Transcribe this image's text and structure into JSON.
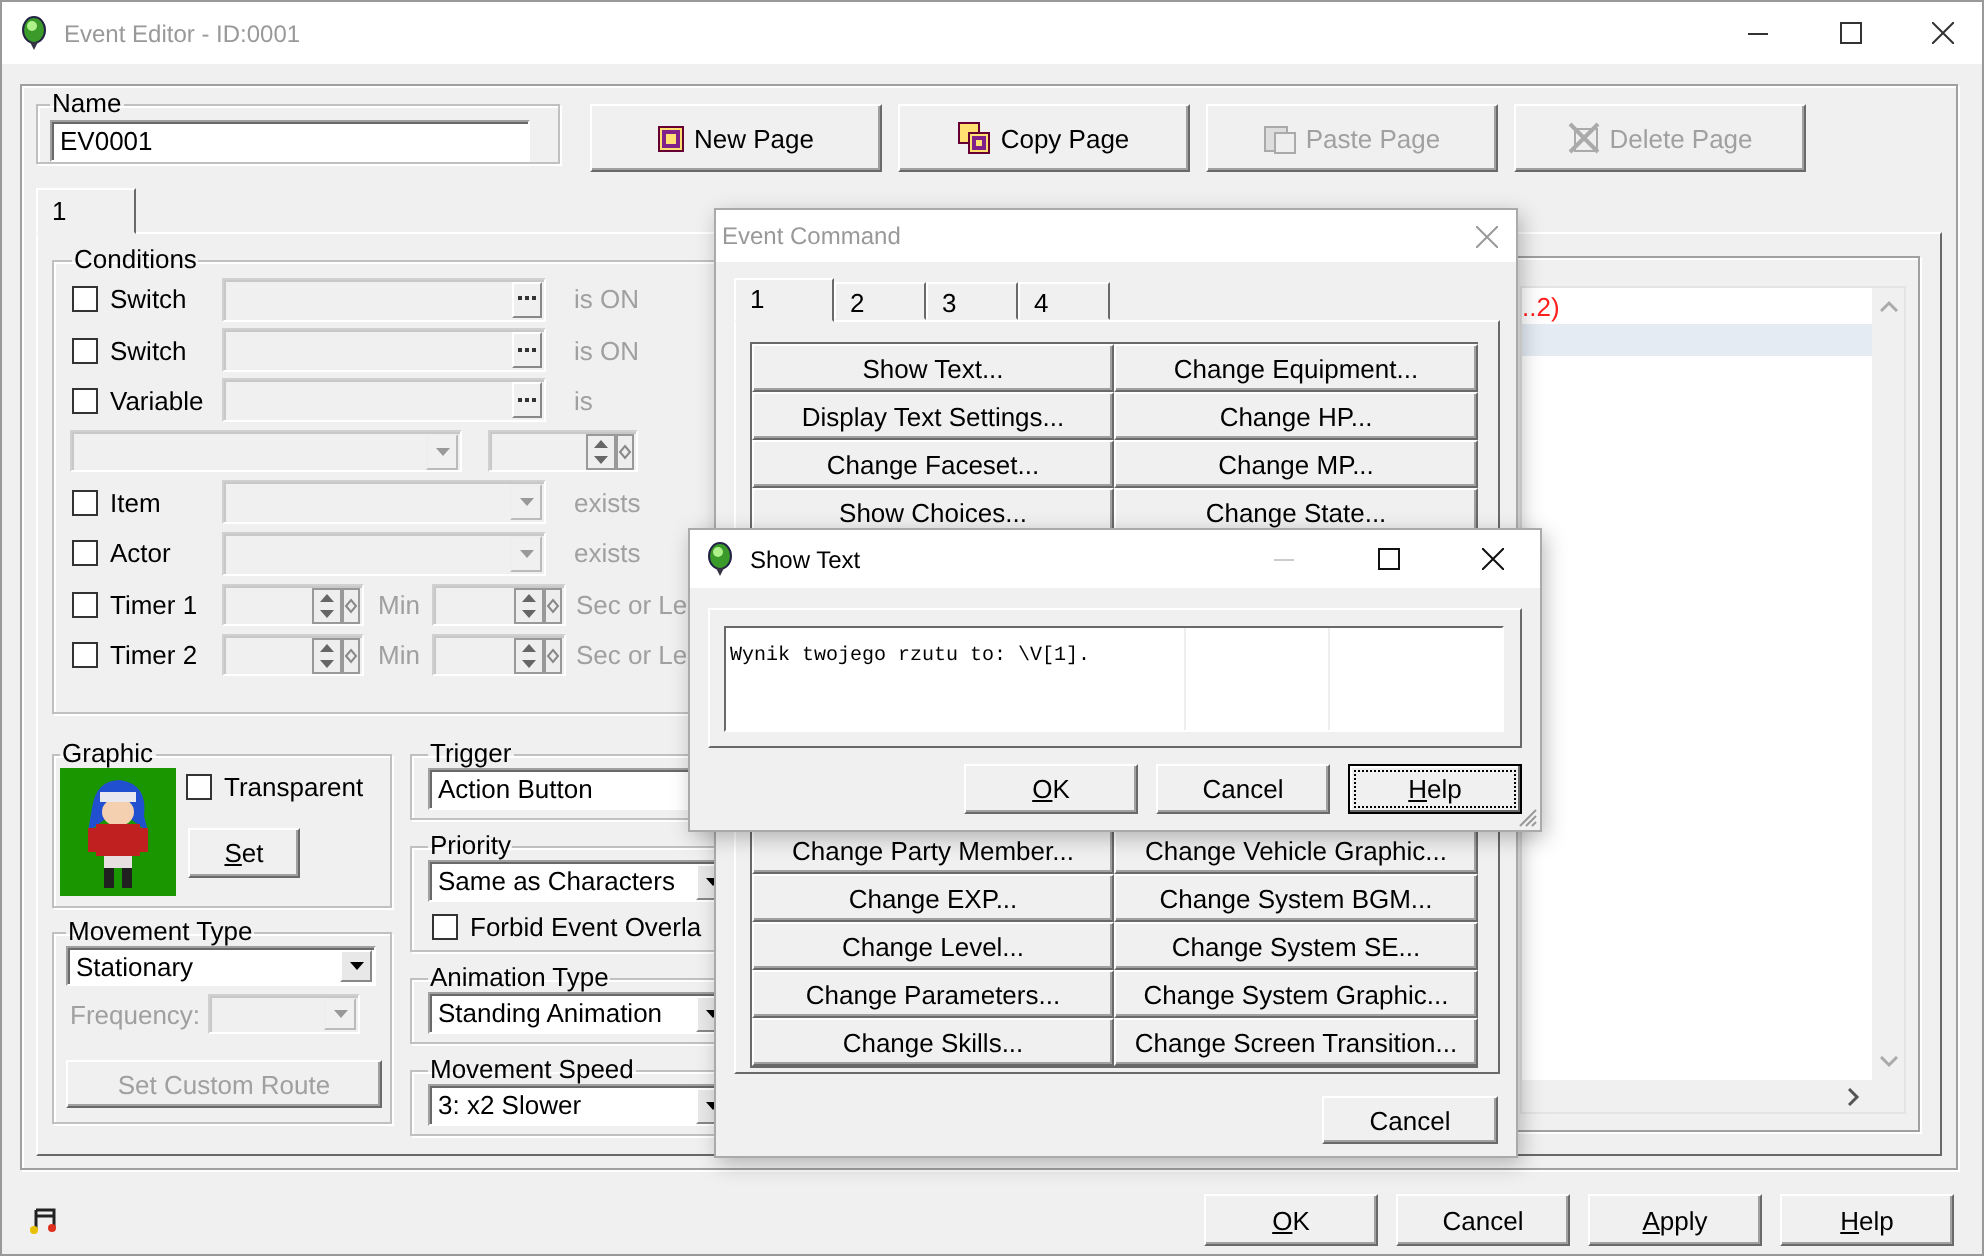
{
  "window": {
    "title": "Event Editor - ID:0001"
  },
  "name_group": {
    "label": "Name",
    "value": "EV0001"
  },
  "page_buttons": [
    {
      "label": "New Page",
      "kind": "new",
      "disabled": false
    },
    {
      "label": "Copy Page",
      "kind": "copy",
      "disabled": false
    },
    {
      "label": "Paste Page",
      "kind": "paste",
      "disabled": true
    },
    {
      "label": "Delete Page",
      "kind": "delete",
      "disabled": true
    }
  ],
  "page_tabs": [
    {
      "label": "1",
      "selected": true
    }
  ],
  "conditions": {
    "title": "Conditions",
    "rows": [
      {
        "kind": "picker",
        "label": "Switch",
        "checked": false,
        "suffix": "is ON"
      },
      {
        "kind": "picker",
        "label": "Switch",
        "checked": false,
        "suffix": "is ON"
      },
      {
        "kind": "picker",
        "label": "Variable",
        "checked": false,
        "suffix": "is"
      },
      {
        "kind": "compare"
      },
      {
        "kind": "select",
        "label": "Item",
        "checked": false,
        "suffix": "exists"
      },
      {
        "kind": "select",
        "label": "Actor",
        "checked": false,
        "suffix": "exists"
      },
      {
        "kind": "timer",
        "label": "Timer 1",
        "checked": false,
        "unit": "Min",
        "suffix": "Sec or Le"
      },
      {
        "kind": "timer",
        "label": "Timer 2",
        "checked": false,
        "unit": "Min",
        "suffix": "Sec or Le"
      }
    ]
  },
  "graphic": {
    "title": "Graphic",
    "transparent": {
      "label": "Transparent",
      "checked": false
    },
    "set_button": {
      "label": "Set",
      "mnemonic": true
    }
  },
  "movement_type": {
    "title": "Movement Type",
    "value": "Stationary",
    "frequency_label": "Frequency:",
    "frequency_disabled": true,
    "route_button": {
      "label": "Set Custom Route",
      "disabled": true
    }
  },
  "trigger": {
    "title": "Trigger",
    "value": "Action Button"
  },
  "priority": {
    "title": "Priority",
    "value": "Same as Characters",
    "forbid_overlap": {
      "label": "Forbid Event Overla",
      "checked": false
    }
  },
  "animation_type": {
    "title": "Animation Type",
    "value": "Standing Animation"
  },
  "movement_speed": {
    "title": "Movement Speed",
    "value": "3: x2 Slower"
  },
  "contents": {
    "lines": [
      {
        "kind": "script",
        "text": "..2)",
        "selected": false
      },
      {
        "kind": "blank",
        "selected": true
      }
    ]
  },
  "footer": {
    "buttons": [
      {
        "label": "OK",
        "mnemonic": true
      },
      {
        "label": "Cancel",
        "mnemonic": false
      },
      {
        "label": "Apply",
        "mnemonic": true
      },
      {
        "label": "Help",
        "mnemonic": true
      }
    ]
  },
  "event_command": {
    "title": "Event Command",
    "tabs": [
      {
        "label": "1",
        "selected": true
      },
      {
        "label": "2",
        "selected": false
      },
      {
        "label": "3",
        "selected": false
      },
      {
        "label": "4",
        "selected": false
      }
    ],
    "rows_top": [
      [
        "Show Text...",
        "Change Equipment..."
      ],
      [
        "Display Text Settings...",
        "Change HP..."
      ],
      [
        "Change Faceset...",
        "Change MP..."
      ],
      [
        "Show Choices...",
        "Change State..."
      ]
    ],
    "rows_bottom": [
      [
        "Change Party Member...",
        "Change Vehicle Graphic..."
      ],
      [
        "Change EXP...",
        "Change System BGM..."
      ],
      [
        "Change Level...",
        "Change System SE..."
      ],
      [
        "Change Parameters...",
        "Change System Graphic..."
      ],
      [
        "Change Skills...",
        "Change Screen Transition..."
      ]
    ],
    "cancel": "Cancel"
  },
  "show_text": {
    "title": "Show Text",
    "text": "Wynik twojego rzutu to: \\V[1].",
    "buttons": [
      {
        "label": "OK",
        "mnemonic": true,
        "focused": false
      },
      {
        "label": "Cancel",
        "mnemonic": false,
        "focused": false
      },
      {
        "label": "Help",
        "mnemonic": true,
        "focused": true
      }
    ]
  }
}
